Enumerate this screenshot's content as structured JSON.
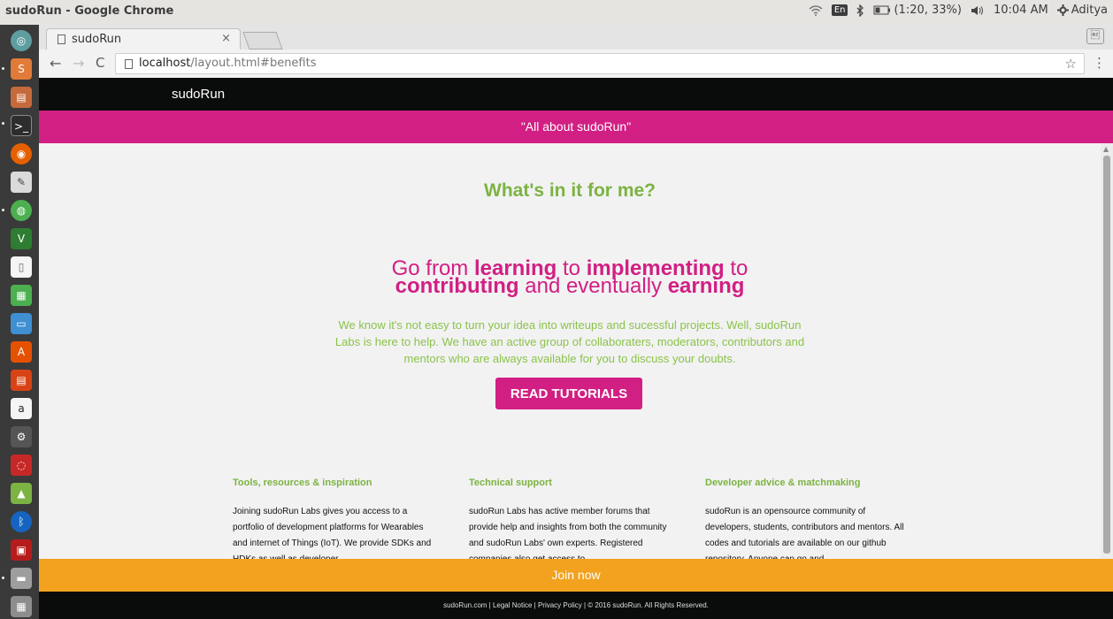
{
  "system": {
    "window_title": "sudoRun - Google Chrome",
    "keyboard": "En",
    "battery": "(1:20, 33%)",
    "time": "10:04 AM",
    "user": "Aditya",
    "icons": [
      "wifi-icon",
      "bluetooth-icon",
      "battery-icon",
      "volume-icon",
      "settings-gear-icon"
    ]
  },
  "launcher": {
    "icons": [
      "dash-icon",
      "sublime-icon",
      "files-icon",
      "terminal-icon",
      "firefox-icon",
      "text-editor-icon",
      "chrome-icon",
      "vim-icon",
      "document-icon",
      "spreadsheet-icon",
      "presentation-icon",
      "software-center-icon",
      "document-viewer-icon",
      "amazon-icon",
      "system-settings-icon",
      "disk-icon",
      "android-icon",
      "bluetooth-icon",
      "screen-icon",
      "drive-icon",
      "trash-icon"
    ]
  },
  "browser": {
    "tab_title": "sudoRun",
    "tab_close": "×",
    "url_host": "localhost",
    "url_path": "/layout.html#benefits",
    "back": "←",
    "forward": "→",
    "reload": "C",
    "bookmark": "☆",
    "menu": "⋮"
  },
  "site": {
    "brand": "sudoRun",
    "banner": "\"All about sudoRun\"",
    "heading": "What's in it for me?",
    "headline": {
      "t1": "Go from ",
      "b1": "learning",
      "t2": " to ",
      "b2": "implementing",
      "t3": " to",
      "b3": "contributing",
      "t4": " and eventually ",
      "b4": "earning"
    },
    "paragraph": "We know it's not easy to turn your idea into writeups and sucessful projects. Well, sudoRun Labs is here to help. We have an active group of collaboraters, moderators, contributors and mentors who are always available for you to discuss your doubts.",
    "cta": "READ TUTORIALS",
    "columns": [
      {
        "title": "Tools, resources & inspiration",
        "body": "Joining sudoRun Labs gives you access to a portfolio of development platforms for Wearables and internet of Things (IoT). We provide SDKs and HDKs as well as developer"
      },
      {
        "title": "Technical support",
        "body": "sudoRun Labs has active member forums that provide help and insights from both the community and sudoRun Labs' own experts. Registered companies also get access to"
      },
      {
        "title": "Developer advice & matchmaking",
        "body": "sudoRun is an opensource community of developers, students, contributors and mentors. All codes and tutorials are available on our github repository. Anyone can go and"
      }
    ],
    "join": "Join now",
    "footer": "sudoRun.com | Legal Notice | Privacy Policy | © 2016 sudoRun. All Rights Reserved."
  },
  "colors": {
    "pink": "#d21f83",
    "green": "#7cb342",
    "orange": "#f2a21e",
    "dark": "#0a0c0b"
  }
}
